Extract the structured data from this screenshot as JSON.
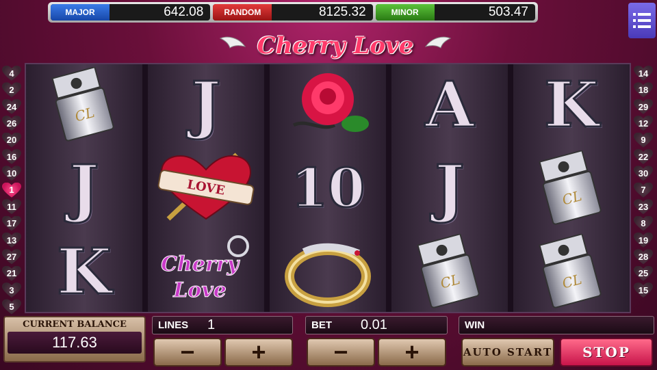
{
  "jackpots": [
    {
      "label": "MAJOR",
      "value": "642.08"
    },
    {
      "label": "RANDOM",
      "value": "8125.32"
    },
    {
      "label": "MINOR",
      "value": "503.47"
    }
  ],
  "menu_icon": "hamburger-menu-icon",
  "logo": "Cherry Love",
  "line_markers_left": [
    "4",
    "2",
    "24",
    "26",
    "20",
    "16",
    "10",
    "1",
    "11",
    "17",
    "13",
    "27",
    "21",
    "3",
    "5"
  ],
  "line_markers_right": [
    "14",
    "18",
    "29",
    "12",
    "9",
    "22",
    "30",
    "7",
    "23",
    "8",
    "19",
    "28",
    "25",
    "15"
  ],
  "active_line": "1",
  "reels": [
    [
      {
        "icon": "lighter-icon",
        "text": ""
      },
      {
        "icon": "letter-j-icon",
        "text": "J"
      },
      {
        "icon": "letter-k-icon",
        "text": "K"
      }
    ],
    [
      {
        "icon": "letter-j-icon",
        "text": "J"
      },
      {
        "icon": "love-heart-dagger-icon",
        "text": "LOVE"
      },
      {
        "icon": "cherry-love-keychain-icon",
        "text": "Cherry Love"
      }
    ],
    [
      {
        "icon": "rose-icon",
        "text": ""
      },
      {
        "icon": "number-10-icon",
        "text": "10"
      },
      {
        "icon": "snake-ring-icon",
        "text": ""
      }
    ],
    [
      {
        "icon": "letter-a-icon",
        "text": "A"
      },
      {
        "icon": "letter-j-icon",
        "text": "J"
      },
      {
        "icon": "lighter-icon",
        "text": ""
      }
    ],
    [
      {
        "icon": "letter-k-icon",
        "text": "K"
      },
      {
        "icon": "lighter-icon",
        "text": ""
      },
      {
        "icon": "lighter-icon",
        "text": ""
      }
    ]
  ],
  "balance": {
    "label": "CURRENT BALANCE",
    "value": "117.63"
  },
  "lines": {
    "label": "LINES",
    "value": "1"
  },
  "bet": {
    "label": "BET",
    "value": "0.01"
  },
  "win": {
    "label": "WIN",
    "value": ""
  },
  "buttons": {
    "minus": "−",
    "plus": "+",
    "auto_start": "AUTO START",
    "stop": "STOP"
  }
}
